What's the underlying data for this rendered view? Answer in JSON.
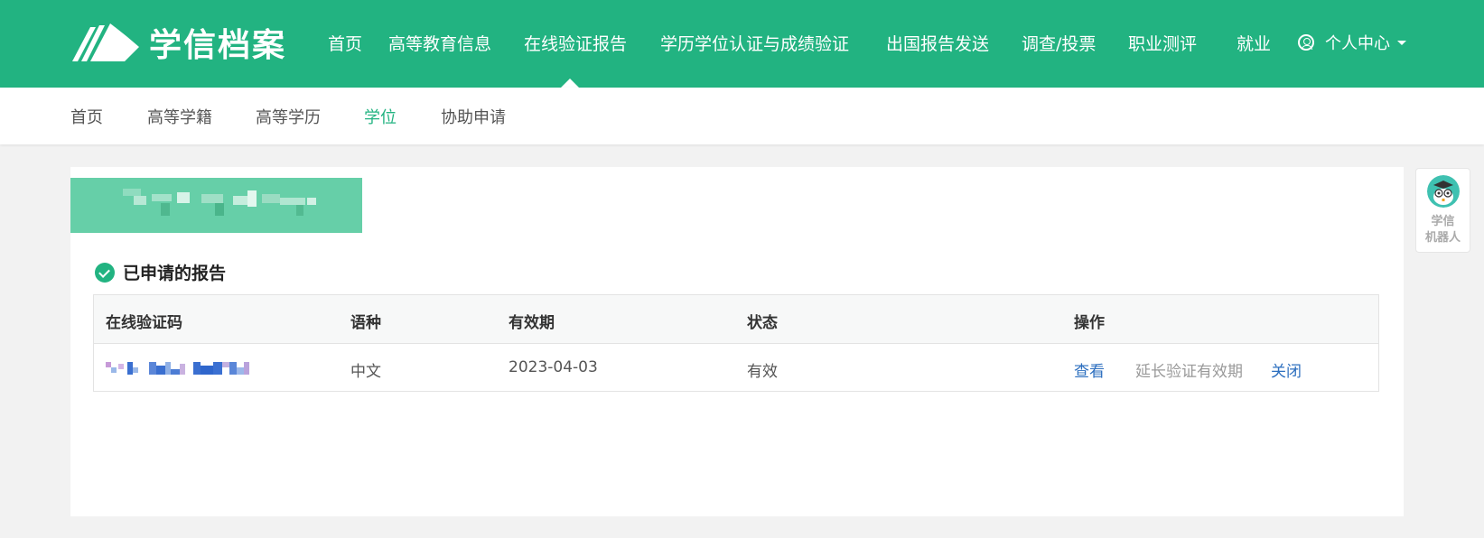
{
  "header": {
    "logo_text": "学信档案",
    "nav": [
      {
        "label": "首页"
      },
      {
        "label": "高等教育信息"
      },
      {
        "label": "在线验证报告"
      },
      {
        "label": "学历学位认证与成绩验证"
      },
      {
        "label": "出国报告发送"
      },
      {
        "label": "调查/投票"
      },
      {
        "label": "职业测评"
      },
      {
        "label": "就业"
      }
    ],
    "active_nav": "在线验证报告",
    "user_menu_label": "个人中心"
  },
  "subnav": {
    "items": [
      {
        "label": "首页"
      },
      {
        "label": "高等学籍"
      },
      {
        "label": "高等学历"
      },
      {
        "label": "学位"
      },
      {
        "label": "协助申请"
      }
    ],
    "active": "学位"
  },
  "section": {
    "title": "已申请的报告"
  },
  "table": {
    "headers": [
      "在线验证码",
      "语种",
      "有效期",
      "状态",
      "操作"
    ],
    "rows": [
      {
        "code": "",
        "language": "中文",
        "expiry": "2023-04-03",
        "status": "有效",
        "actions": {
          "view": "查看",
          "extend": "延长验证有效期",
          "close": "关闭"
        }
      }
    ]
  },
  "robot": {
    "line1": "学信",
    "line2": "机器人"
  },
  "colors": {
    "brand": "#22b381",
    "link": "#2d6fbf",
    "banner": "#66cfa8"
  }
}
